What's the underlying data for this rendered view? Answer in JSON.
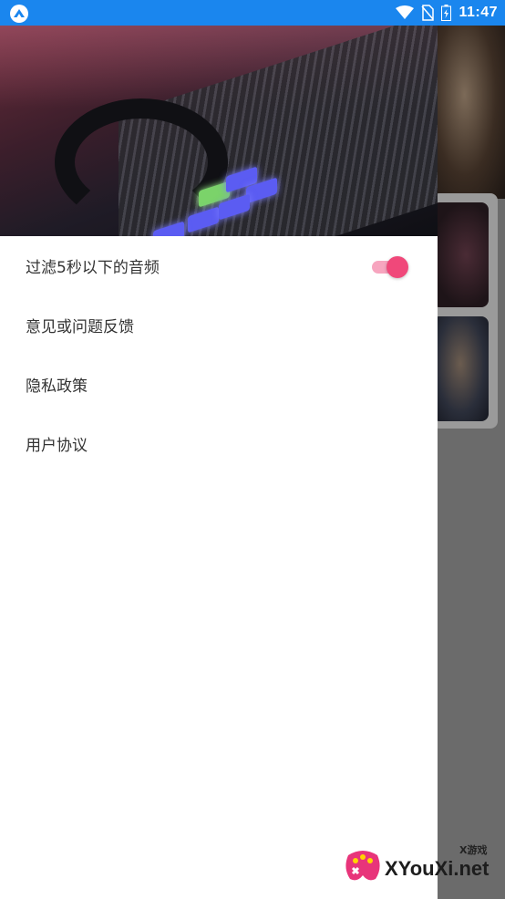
{
  "status_bar": {
    "time": "11:47",
    "icons": [
      "app-notification-icon",
      "wifi-icon",
      "no-sim-icon",
      "battery-icon"
    ],
    "background_color": "#1a86ee"
  },
  "drawer": {
    "header_image": "music-mixer-headphones",
    "menu": [
      {
        "label": "过滤5秒以下的音频",
        "has_toggle": true,
        "toggle_on": true
      },
      {
        "label": "意见或问题反馈"
      },
      {
        "label": "隐私政策"
      },
      {
        "label": "用户协议"
      }
    ],
    "accent_color": "#f0487a"
  },
  "watermark": {
    "text": "XYouXi.net",
    "small_text": "X游戏"
  }
}
